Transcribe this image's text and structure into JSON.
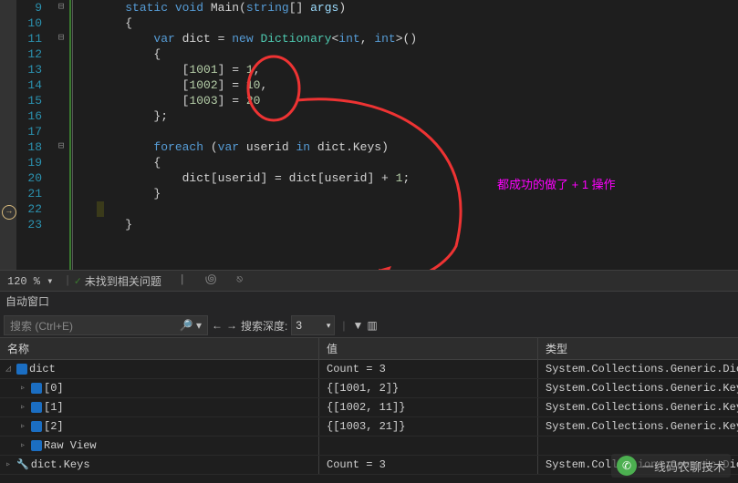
{
  "lines": [
    9,
    10,
    11,
    12,
    13,
    14,
    15,
    16,
    17,
    18,
    19,
    20,
    21,
    22,
    23
  ],
  "code": {
    "l9": {
      "a": "static void",
      "b": " Main",
      "c": "(",
      "d": "string",
      "e": "[] ",
      "f": "args",
      "g": ")"
    },
    "l11": {
      "a": "var",
      "b": " dict ",
      "c": "= ",
      "d": "new",
      "e": " Dictionary",
      "f": "<",
      "g": "int",
      "h": ", ",
      "i": "int",
      "j": ">()"
    },
    "l13": {
      "a": "[",
      "b": "1001",
      "c": "] = ",
      "d": "1",
      "e": ","
    },
    "l14": {
      "a": "[",
      "b": "1002",
      "c": "] = ",
      "d": "10",
      "e": ","
    },
    "l15": {
      "a": "[",
      "b": "1003",
      "c": "] = ",
      "d": "20"
    },
    "l18": {
      "a": "foreach",
      "b": " (",
      "c": "var",
      "d": " userid ",
      "e": "in",
      "f": " dict.Keys)"
    },
    "l20": {
      "a": "dict[userid] = dict[userid] + ",
      "b": "1",
      "c": ";"
    }
  },
  "annotation": "都成功的做了 + 1 操作",
  "zoom": "120 %",
  "status_ok": "✓",
  "status_text": "未找到相关问题",
  "panel_title": "自动窗口",
  "search": {
    "placeholder": "搜索 (Ctrl+E)",
    "depth_label": "搜索深度:",
    "depth_value": "3"
  },
  "headers": {
    "name": "名称",
    "value": "值",
    "type": "类型"
  },
  "rows": [
    {
      "lvl": 0,
      "exp": "◿",
      "icon": "cube",
      "name": "dict",
      "value": "Count = 3",
      "type": "System.Collections.Generic.Dictionary<int, int>"
    },
    {
      "lvl": 1,
      "exp": "▹",
      "icon": "cube",
      "name": "[0]",
      "value": "{[1001, 2]}",
      "type": "System.Collections.Generic.KeyValuePair<int, int>"
    },
    {
      "lvl": 1,
      "exp": "▹",
      "icon": "cube",
      "name": "[1]",
      "value": "{[1002, 11]}",
      "type": "System.Collections.Generic.KeyValuePair<int, int>"
    },
    {
      "lvl": 1,
      "exp": "▹",
      "icon": "cube",
      "name": "[2]",
      "value": "{[1003, 21]}",
      "type": "System.Collections.Generic.KeyValuePair<int, int>"
    },
    {
      "lvl": 1,
      "exp": "▹",
      "icon": "cube",
      "name": "Raw View",
      "value": "",
      "type": ""
    },
    {
      "lvl": 0,
      "exp": "▹",
      "icon": "wrench",
      "name": "dict.Keys",
      "value": "Count = 3",
      "type": "System.Collections.Generic.Dictionary<int, int>.KeyCollection"
    }
  ],
  "watermark": "一线码农聊技术"
}
